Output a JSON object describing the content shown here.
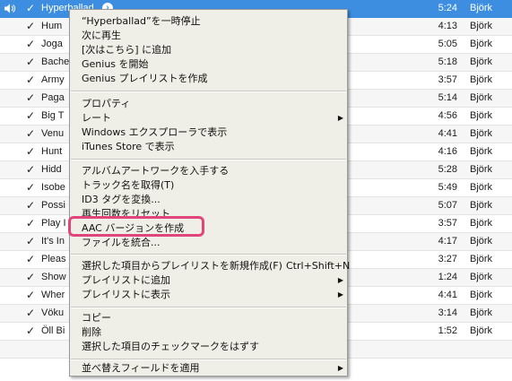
{
  "tracks": [
    {
      "title": "Hyperballad",
      "time": "5:24",
      "artist": "Björk",
      "playing": true,
      "selected": true
    },
    {
      "title": "Hum",
      "time": "4:13",
      "artist": "Björk"
    },
    {
      "title": "Joga",
      "time": "5:05",
      "artist": "Björk"
    },
    {
      "title": "Bache",
      "time": "5:18",
      "artist": "Björk"
    },
    {
      "title": "Army",
      "time": "3:57",
      "artist": "Björk"
    },
    {
      "title": "Paga",
      "time": "5:14",
      "artist": "Björk"
    },
    {
      "title": "Big T",
      "time": "4:56",
      "artist": "Björk"
    },
    {
      "title": "Venu",
      "time": "4:41",
      "artist": "Björk"
    },
    {
      "title": "Hunt",
      "time": "4:16",
      "artist": "Björk"
    },
    {
      "title": "Hidd",
      "time": "5:28",
      "artist": "Björk"
    },
    {
      "title": "Isobe",
      "time": "5:49",
      "artist": "Björk"
    },
    {
      "title": "Possi",
      "time": "5:07",
      "artist": "Björk"
    },
    {
      "title": "Play I",
      "time": "3:57",
      "artist": "Björk"
    },
    {
      "title": "It's In",
      "time": "4:17",
      "artist": "Björk"
    },
    {
      "title": "Pleas",
      "time": "3:27",
      "artist": "Björk"
    },
    {
      "title": "Show",
      "time": "1:24",
      "artist": "Björk"
    },
    {
      "title": "Wher",
      "time": "4:41",
      "artist": "Björk"
    },
    {
      "title": "Vöku",
      "time": "3:14",
      "artist": "Björk"
    },
    {
      "title": "Öll Bi",
      "time": "1:52",
      "artist": "Björk"
    },
    {
      "title": "",
      "time": "",
      "artist": ""
    }
  ],
  "check_mark": "✓",
  "menu": {
    "g1": [
      "“Hyperballad”を一時停止",
      "次に再生",
      "[次はこちら] に追加",
      "Genius を開始",
      "Genius プレイリストを作成"
    ],
    "g2": [
      "プロパティ",
      "レート",
      "Windows エクスプローラで表示",
      "iTunes Store で表示"
    ],
    "g3": [
      "アルバムアートワークを入手する",
      "トラック名を取得(T)",
      "ID3 タグを変換...",
      "再生回数をリセット",
      "AAC バージョンを作成",
      "ファイルを統合..."
    ],
    "g4": [
      "選択した項目からプレイリストを新規作成(F)",
      "プレイリストに追加",
      "プレイリストに表示"
    ],
    "g4_shortcut": "Ctrl+Shift+N",
    "g5": [
      "コピー",
      "削除",
      "選択した項目のチェックマークをはずす"
    ],
    "g6": [
      "並べ替えフィールドを適用"
    ],
    "submenu_arrow": "▶"
  },
  "colors": {
    "selection": "#3d8ee0",
    "highlight": "#e0467c",
    "menu_bg": "#f0efe7"
  }
}
